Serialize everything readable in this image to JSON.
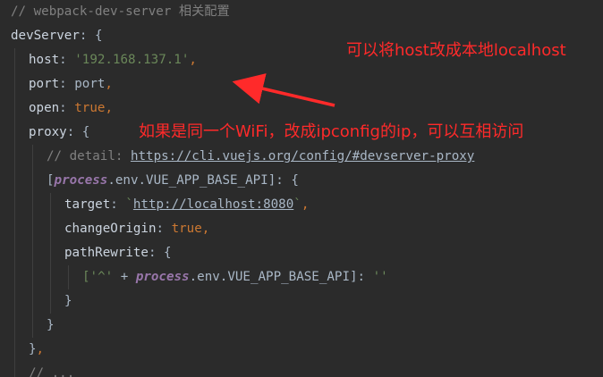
{
  "editor": {
    "lines": [
      {
        "indent": 0,
        "tokens": [
          {
            "t": "// webpack-dev-server 相关配置",
            "c": "comment"
          }
        ]
      },
      {
        "indent": 0,
        "tokens": [
          {
            "t": "devServer",
            "c": "key"
          },
          {
            "t": ": {",
            "c": "plain"
          }
        ]
      },
      {
        "indent": 1,
        "tokens": [
          {
            "t": "host",
            "c": "key"
          },
          {
            "t": ": ",
            "c": "plain"
          },
          {
            "t": "'192.168.137.1'",
            "c": "string"
          },
          {
            "t": ",",
            "c": "punct"
          }
        ]
      },
      {
        "indent": 1,
        "tokens": [
          {
            "t": "port",
            "c": "key"
          },
          {
            "t": ": port",
            "c": "plain"
          },
          {
            "t": ",",
            "c": "punct"
          }
        ]
      },
      {
        "indent": 1,
        "tokens": [
          {
            "t": "open",
            "c": "key"
          },
          {
            "t": ": ",
            "c": "plain"
          },
          {
            "t": "true",
            "c": "keyword"
          },
          {
            "t": ",",
            "c": "punct"
          }
        ]
      },
      {
        "indent": 1,
        "tokens": [
          {
            "t": "proxy",
            "c": "key"
          },
          {
            "t": ": {",
            "c": "plain"
          }
        ]
      },
      {
        "indent": 2,
        "tokens": [
          {
            "t": "// detail: ",
            "c": "comment"
          },
          {
            "t": "https://cli.vuejs.org/config/#devserver-proxy",
            "c": "url"
          }
        ]
      },
      {
        "indent": 2,
        "tokens": [
          {
            "t": "[",
            "c": "plain"
          },
          {
            "t": "process",
            "c": "italic"
          },
          {
            "t": ".env.VUE_APP_BASE_API]: {",
            "c": "plain"
          }
        ]
      },
      {
        "indent": 3,
        "tokens": [
          {
            "t": "target",
            "c": "key"
          },
          {
            "t": ": ",
            "c": "plain"
          },
          {
            "t": "`",
            "c": "string"
          },
          {
            "t": "http://localhost:8080",
            "c": "url"
          },
          {
            "t": "`",
            "c": "string"
          },
          {
            "t": ",",
            "c": "punct"
          }
        ]
      },
      {
        "indent": 3,
        "tokens": [
          {
            "t": "changeOrigin",
            "c": "key"
          },
          {
            "t": ": ",
            "c": "plain"
          },
          {
            "t": "true",
            "c": "keyword"
          },
          {
            "t": ",",
            "c": "punct"
          }
        ]
      },
      {
        "indent": 3,
        "tokens": [
          {
            "t": "pathRewrite",
            "c": "key"
          },
          {
            "t": ": {",
            "c": "plain"
          }
        ]
      },
      {
        "indent": 4,
        "tokens": [
          {
            "t": "['^' ",
            "c": "string"
          },
          {
            "t": "+ ",
            "c": "plain"
          },
          {
            "t": "process",
            "c": "italic"
          },
          {
            "t": ".env.VUE_APP_BASE_API]: ",
            "c": "plain"
          },
          {
            "t": "''",
            "c": "string"
          }
        ]
      },
      {
        "indent": 3,
        "tokens": [
          {
            "t": "}",
            "c": "plain"
          }
        ]
      },
      {
        "indent": 2,
        "tokens": [
          {
            "t": "}",
            "c": "plain"
          }
        ]
      },
      {
        "indent": 1,
        "tokens": [
          {
            "t": "}",
            "c": "plain"
          },
          {
            "t": ",",
            "c": "punct"
          }
        ]
      },
      {
        "indent": 1,
        "tokens": [
          {
            "t": "// ...",
            "c": "comment"
          }
        ]
      }
    ]
  },
  "annotations": {
    "note_host": "可以将host改成本地localhost",
    "note_wifi": "如果是同一个WiFi，改成ipconfig的ip，可以互相访问"
  },
  "colors": {
    "background": "#2b2b2b",
    "annotation": "#ff2a2a"
  }
}
